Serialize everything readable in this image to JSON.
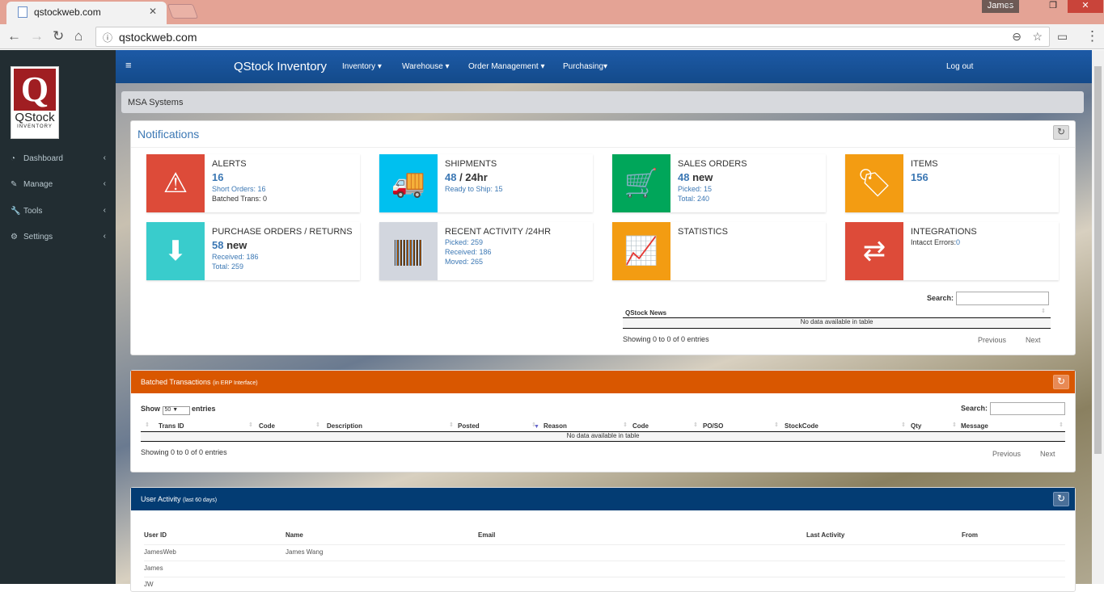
{
  "browser": {
    "tab_title": "qstockweb.com",
    "url": "qstockweb.com",
    "user": "James"
  },
  "sidebar": {
    "logo_top": "Q",
    "logo_name": "QStock",
    "logo_sub": "INVENTORY",
    "items": [
      {
        "label": "Dashboard",
        "icon": "dashboard-icon"
      },
      {
        "label": "Manage",
        "icon": "edit-icon"
      },
      {
        "label": "Tools",
        "icon": "wrench-icon"
      },
      {
        "label": "Settings",
        "icon": "gear-icon"
      }
    ]
  },
  "topnav": {
    "brand": "QStock Inventory",
    "menus": [
      "Inventory",
      "Warehouse",
      "Order Management",
      "Purchasing"
    ],
    "logout": "Log out"
  },
  "breadcrumb": "MSA Systems",
  "notifications": {
    "title": "Notifications",
    "cards": [
      {
        "title": "Alerts",
        "big": "16",
        "big_suffix": "",
        "lines": [
          "Short Orders: 16",
          "Batched Trans: 0"
        ],
        "color": "#dd4b39",
        "icon": "warning-icon"
      },
      {
        "title": "Shipments",
        "big": "48",
        "big_suffix": " / 24hr",
        "lines": [
          "Ready to Ship: 15"
        ],
        "color": "#00c0ef",
        "icon": "truck-icon"
      },
      {
        "title": "Sales Orders",
        "big": "48",
        "big_suffix": " new",
        "lines": [
          "Picked: 15",
          "Total: 240"
        ],
        "color": "#00a65a",
        "icon": "cart-icon"
      },
      {
        "title": "Items",
        "big": "156",
        "big_suffix": "",
        "lines": [],
        "color": "#f39c12",
        "icon": "tag-icon"
      },
      {
        "title": "Purchase Orders / Returns",
        "big": "58",
        "big_suffix": " new",
        "lines": [
          "Received: 186",
          "Total: 259"
        ],
        "color": "#39cccc",
        "icon": "archive-download-icon"
      },
      {
        "title": "Recent Activity /24HR",
        "big": "",
        "big_suffix": "",
        "lines": [
          "Picked: 259",
          "Received: 186",
          "Moved: 265"
        ],
        "color": "#d2d6de",
        "icon": "barcode-icon"
      },
      {
        "title": "Statistics",
        "big": "",
        "big_suffix": "",
        "lines": [],
        "color": "#f39c12",
        "icon": "chart-line-icon"
      },
      {
        "title": "Integrations",
        "big": "",
        "big_suffix": "",
        "lines": [
          "Intacct Errors:",
          "0"
        ],
        "color": "#dd4b39",
        "icon": "exchange-icon"
      }
    ],
    "news": {
      "search_label": "Search:",
      "column": "QStock News",
      "empty": "No data available in table",
      "info": "Showing 0 to 0 of 0 entries",
      "prev": "Previous",
      "next": "Next"
    }
  },
  "batched": {
    "title": "Batched Transactions",
    "subtitle": "(in ERP Interface)",
    "show": "Show",
    "page_size": "50",
    "entries": "entries",
    "search_label": "Search:",
    "columns": [
      "Trans ID",
      "Code",
      "Description",
      "Posted",
      "Reason",
      "Code",
      "PO/SO",
      "StockCode",
      "Qty",
      "Message"
    ],
    "empty": "No data available in table",
    "info": "Showing 0 to 0 of 0 entries",
    "prev": "Previous",
    "next": "Next"
  },
  "user_activity": {
    "title": "User Activity",
    "subtitle": "(last 60 days)",
    "columns": [
      "User ID",
      "Name",
      "Email",
      "Last Activity",
      "From"
    ],
    "rows": [
      [
        "JamesWeb",
        "James Wang"
      ],
      [
        "James",
        ""
      ],
      [
        "JW",
        ""
      ]
    ]
  }
}
